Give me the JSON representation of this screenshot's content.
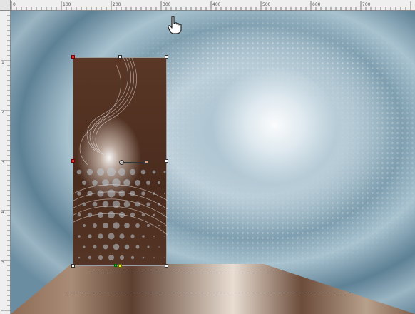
{
  "ruler": {
    "top_labels": [
      "0",
      "100",
      "200",
      "300",
      "400",
      "500",
      "600",
      "700"
    ],
    "left_labels": [
      "1",
      "2",
      "3",
      "4",
      "5"
    ]
  },
  "canvas": {
    "background_colors": [
      "#6b8da1",
      "#a8c2cf",
      "#ffffff"
    ],
    "floor_colors": [
      "#5e4030",
      "#e8ddd2",
      "#8e6b55"
    ]
  },
  "selection": {
    "fill_color": "#4a2c1e",
    "corner_handle_colors": [
      "#e03030",
      "#3c3",
      "#ee3"
    ]
  },
  "icons": {
    "cursor": "pointing-hand-icon",
    "pivot": "rotation-pivot-icon"
  }
}
